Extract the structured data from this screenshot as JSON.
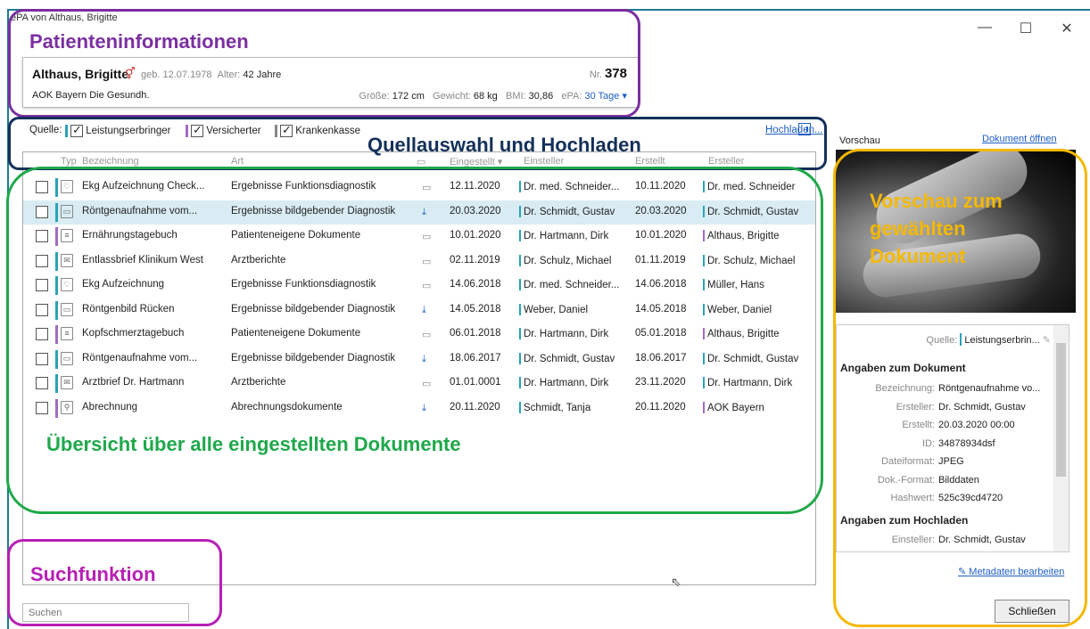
{
  "window": {
    "title": "ePA von Althaus, Brigitte",
    "ctrl_min": "—",
    "ctrl_max": "☐",
    "ctrl_close": "✕"
  },
  "patient": {
    "name": "Althaus, Brigitte",
    "gender_symbol": "⚥",
    "geb_label": "geb.",
    "geb": "12.07.1978",
    "age_label": "Alter:",
    "age": "42 Jahre",
    "nr_label": "Nr.",
    "nr": "378",
    "kasse": "AOK Bayern Die Gesundh.",
    "groesse_label": "Größe:",
    "groesse": "172 cm",
    "gewicht_label": "Gewicht:",
    "gewicht": "68 kg",
    "bmi_label": "BMI:",
    "bmi": "30,86",
    "epa_label": "ePA:",
    "epa": "30 Tage ▾"
  },
  "sources": {
    "label": "Quelle:",
    "items": [
      {
        "label": "Leistungserbringer",
        "color": "#2aa3b8"
      },
      {
        "label": "Versicherter",
        "color": "#a36bc4"
      },
      {
        "label": "Krankenkasse",
        "color": "#888888"
      }
    ],
    "upload_link": "Hochladen..."
  },
  "table": {
    "headers": [
      "Typ",
      "Bezeichnung",
      "Art",
      "Eingestellt ▾",
      "Einsteller",
      "Erstellt",
      "Ersteller"
    ],
    "rows": [
      {
        "type": "ekg",
        "typecolor": "#2aa3b8",
        "bez": "Ekg Aufzeichnung Check...",
        "art": "Ergebnisse Funktionsdiagnostik",
        "icon": "▭",
        "eingestellt": "12.11.2020",
        "einsteller": "Dr. med. Schneider...",
        "erstellt": "10.11.2020",
        "ersteller": "Dr. med. Schneider",
        "selected": false
      },
      {
        "type": "img",
        "typecolor": "#2aa3b8",
        "bez": "Röntgenaufnahme vom...",
        "art": "Ergebnisse bildgebender Diagnostik",
        "icon": "⤓",
        "eingestellt": "20.03.2020",
        "einsteller": "Dr. Schmidt, Gustav",
        "erstellt": "20.03.2020",
        "ersteller": "Dr. Schmidt, Gustav",
        "selected": true
      },
      {
        "type": "doc",
        "typecolor": "#a36bc4",
        "bez": "Ernährungstagebuch",
        "art": "Patienteneigene Dokumente",
        "icon": "▭",
        "eingestellt": "10.01.2020",
        "einsteller": "Dr. Hartmann, Dirk",
        "erstellt": "10.01.2020",
        "ersteller": "Althaus, Brigitte",
        "selected": false
      },
      {
        "type": "mail",
        "typecolor": "#2aa3b8",
        "bez": "Entlassbrief Klinikum West",
        "art": "Arztberichte",
        "icon": "▭",
        "eingestellt": "02.11.2019",
        "einsteller": "Dr. Schulz, Michael",
        "erstellt": "01.11.2019",
        "ersteller": "Dr. Schulz, Michael",
        "selected": false
      },
      {
        "type": "ekg",
        "typecolor": "#2aa3b8",
        "bez": "Ekg Aufzeichnung",
        "art": "Ergebnisse Funktionsdiagnostik",
        "icon": "▭",
        "eingestellt": "14.06.2018",
        "einsteller": "Dr. med. Schneider...",
        "erstellt": "14.06.2018",
        "ersteller": "Müller, Hans",
        "selected": false
      },
      {
        "type": "img",
        "typecolor": "#2aa3b8",
        "bez": "Röntgenbild Rücken",
        "art": "Ergebnisse bildgebender Diagnostik",
        "icon": "⤓",
        "eingestellt": "14.05.2018",
        "einsteller": "Weber, Daniel",
        "erstellt": "14.05.2018",
        "ersteller": "Weber, Daniel",
        "selected": false
      },
      {
        "type": "doc",
        "typecolor": "#a36bc4",
        "bez": "Kopfschmerztagebuch",
        "art": "Patienteneigene Dokumente",
        "icon": "▭",
        "eingestellt": "06.01.2018",
        "einsteller": "Dr. Hartmann, Dirk",
        "erstellt": "05.01.2018",
        "ersteller": "Althaus, Brigitte",
        "selected": false
      },
      {
        "type": "img",
        "typecolor": "#2aa3b8",
        "bez": "Röntgenaufnahme vom...",
        "art": "Ergebnisse bildgebender Diagnostik",
        "icon": "⤓",
        "eingestellt": "18.06.2017",
        "einsteller": "Dr. Schmidt, Gustav",
        "erstellt": "18.06.2017",
        "ersteller": "Dr. Schmidt, Gustav",
        "selected": false
      },
      {
        "type": "mail",
        "typecolor": "#2aa3b8",
        "bez": "Arztbrief Dr. Hartmann",
        "art": "Arztberichte",
        "icon": "▭",
        "eingestellt": "01.01.0001",
        "einsteller": "Dr. Hartmann, Dirk",
        "erstellt": "23.11.2020",
        "ersteller": "Dr. Hartmann, Dirk",
        "selected": false
      },
      {
        "type": "bill",
        "typecolor": "#a36bc4",
        "bez": "Abrechnung",
        "art": "Abrechnungsdokumente",
        "icon": "⤓",
        "eingestellt": "20.11.2020",
        "einsteller": "Schmidt, Tanja",
        "erstellt": "20.11.2020",
        "ersteller": "AOK Bayern",
        "selected": false
      }
    ]
  },
  "search": {
    "placeholder": "Suchen"
  },
  "preview": {
    "label": "Vorschau",
    "open_link": "Dokument öffnen",
    "quelle_label": "Quelle:",
    "quelle_value": "Leistungserbrin...",
    "section_doc": "Angaben zum Dokument",
    "doc_fields": [
      {
        "k": "Bezeichnung:",
        "v": "Röntgenaufnahme vo..."
      },
      {
        "k": "Ersteller:",
        "v": "Dr. Schmidt, Gustav"
      },
      {
        "k": "Erstellt:",
        "v": "20.03.2020 00:00"
      },
      {
        "k": "ID:",
        "v": "34878934dsf"
      },
      {
        "k": "Dateiformat:",
        "v": "JPEG"
      },
      {
        "k": "Dok.-Format:",
        "v": "Bilddaten"
      },
      {
        "k": "Hashwert:",
        "v": "525c39cd4720"
      }
    ],
    "section_upload": "Angaben zum Hochladen",
    "upload_fields": [
      {
        "k": "Einsteller:",
        "v": "Dr. Schmidt, Gustav"
      }
    ],
    "edit_link": "Metadaten bearbeiten"
  },
  "close_button": "Schließen",
  "annotations": {
    "patient": {
      "label": "Patienteninformationen",
      "color": "#7b2fa0"
    },
    "source": {
      "label": "Quellauswahl und Hochladen",
      "color": "#13305a"
    },
    "overview": {
      "label": "Übersicht über alle eingestellten Dokumente",
      "color": "#1fa84a"
    },
    "search": {
      "label": "Suchfunktion",
      "color": "#b81fb5"
    },
    "preview": {
      "label": "Vorschau zum gewählten Dokument",
      "color": "#f5b800"
    }
  }
}
